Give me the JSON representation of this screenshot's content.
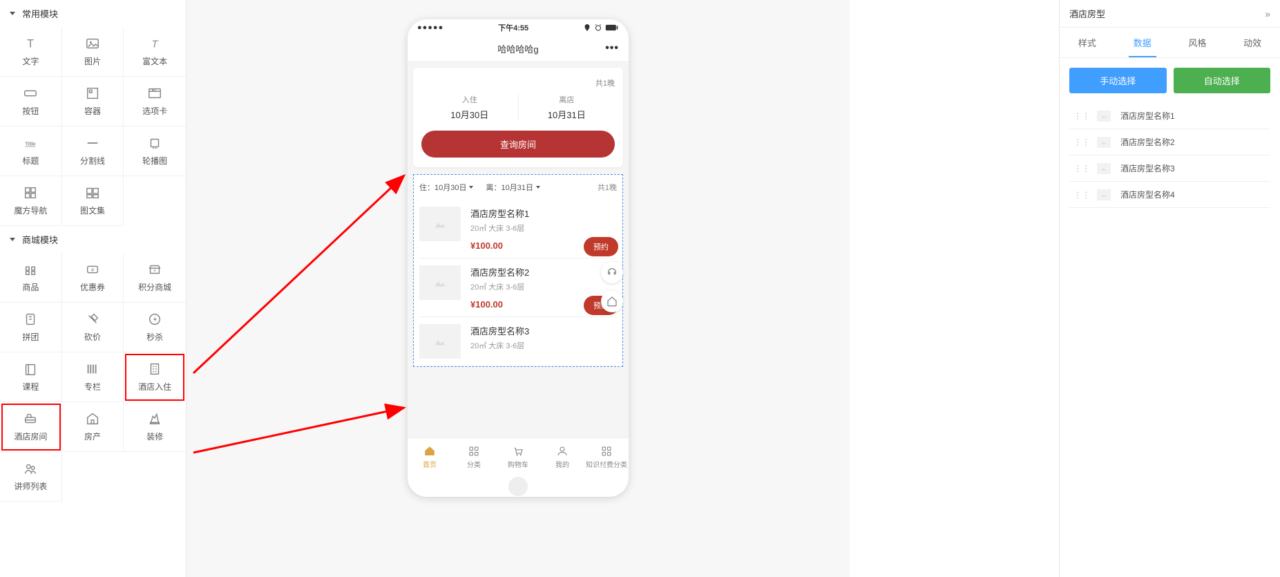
{
  "left": {
    "section_common": "常用模块",
    "section_mall": "商城模块",
    "common_items": [
      {
        "label": "文字",
        "icon": "text"
      },
      {
        "label": "图片",
        "icon": "image"
      },
      {
        "label": "富文本",
        "icon": "richtext"
      },
      {
        "label": "按钮",
        "icon": "button"
      },
      {
        "label": "容器",
        "icon": "container"
      },
      {
        "label": "选项卡",
        "icon": "tab"
      },
      {
        "label": "标题",
        "icon": "title"
      },
      {
        "label": "分割线",
        "icon": "divider"
      },
      {
        "label": "轮播图",
        "icon": "carousel"
      },
      {
        "label": "魔方导航",
        "icon": "grid-nav"
      },
      {
        "label": "图文集",
        "icon": "gallery"
      }
    ],
    "mall_items": [
      {
        "label": "商品",
        "icon": "goods"
      },
      {
        "label": "优惠券",
        "icon": "coupon"
      },
      {
        "label": "积分商城",
        "icon": "points"
      },
      {
        "label": "拼团",
        "icon": "group"
      },
      {
        "label": "砍价",
        "icon": "bargain"
      },
      {
        "label": "秒杀",
        "icon": "flash"
      },
      {
        "label": "课程",
        "icon": "course"
      },
      {
        "label": "专栏",
        "icon": "column"
      },
      {
        "label": "酒店入住",
        "icon": "hotel-checkin",
        "highlight": true
      },
      {
        "label": "酒店房间",
        "icon": "hotel-room",
        "highlight": true
      },
      {
        "label": "房产",
        "icon": "realestate"
      },
      {
        "label": "装修",
        "icon": "decoration"
      },
      {
        "label": "讲师列表",
        "icon": "teachers"
      }
    ]
  },
  "phone": {
    "time": "下午4:55",
    "title": "哈哈哈哈g",
    "search_card": {
      "nights": "共1晚",
      "checkin_label": "入住",
      "checkout_label": "离店",
      "checkin_date": "10月30日",
      "checkout_date": "10月31日",
      "button": "查询房间"
    },
    "room_list": {
      "head_in_label": "住：",
      "head_in_date": "10月30日",
      "head_out_label": "离：",
      "head_out_date": "10月31日",
      "head_nights": "共1晚",
      "items": [
        {
          "name": "酒店房型名称1",
          "desc": "20㎡  大床  3-6层",
          "price": "¥100.00",
          "badge": "预约"
        },
        {
          "name": "酒店房型名称2",
          "desc": "20㎡  大床  3-6层",
          "price": "¥100.00",
          "badge": "预约"
        },
        {
          "name": "酒店房型名称3",
          "desc": "20㎡  大床  3-6层",
          "price": "",
          "badge": ""
        }
      ]
    },
    "tabbar": [
      {
        "label": "首页",
        "active": true
      },
      {
        "label": "分类"
      },
      {
        "label": "购物车"
      },
      {
        "label": "我的"
      },
      {
        "label": "知识付费分类"
      }
    ]
  },
  "right": {
    "title": "酒店房型",
    "tabs": [
      "样式",
      "数据",
      "风格",
      "动效"
    ],
    "active_tab": 1,
    "btn_manual": "手动选择",
    "btn_auto": "自动选择",
    "room_types": [
      {
        "name": "酒店房型名称1"
      },
      {
        "name": "酒店房型名称2"
      },
      {
        "name": "酒店房型名称3"
      },
      {
        "name": "酒店房型名称4"
      }
    ]
  }
}
